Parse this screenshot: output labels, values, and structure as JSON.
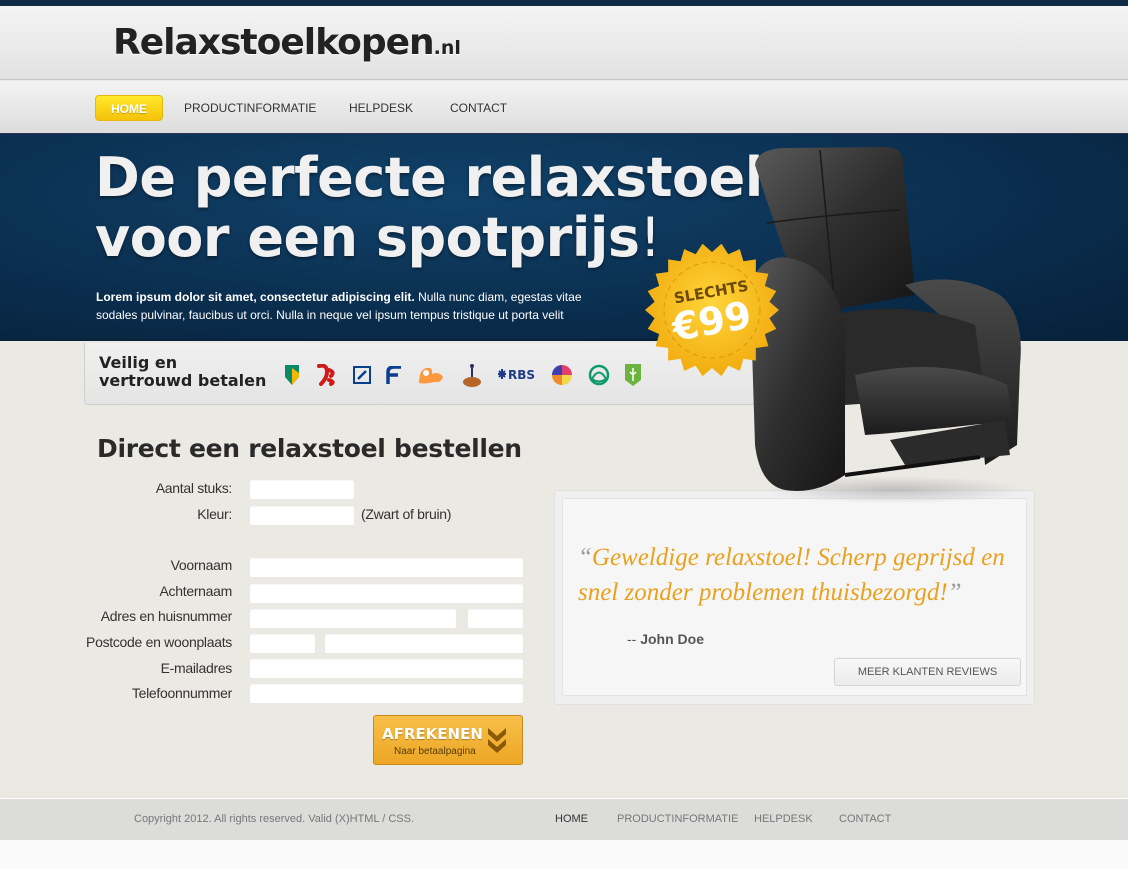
{
  "header": {
    "logo_main": "Relaxstoelkopen",
    "logo_tld": ".nl"
  },
  "nav": {
    "items": [
      {
        "label": "HOME",
        "active": true
      },
      {
        "label": "PRODUCTINFORMATIE",
        "active": false
      },
      {
        "label": "HELPDESK",
        "active": false
      },
      {
        "label": "CONTACT",
        "active": false
      }
    ]
  },
  "hero": {
    "headline_line1": "De perfecte relaxstoel",
    "headline_line2": "voor een spotprijs",
    "headline_excl": "!",
    "intro_bold": "Lorem ipsum dolor sit amet, consectetur adipiscing elit.",
    "intro_rest": " Nulla nunc diam, egestas vitae sodales pulvinar, faucibus ut orci. Nulla in neque vel ipsum tempus tristique ut porta velit",
    "badge_label": "SLECHTS",
    "badge_price": "€99"
  },
  "payment": {
    "title_line1": "Veilig en",
    "title_line2": "vertrouwd betalen",
    "banks": [
      "abn-amro-icon",
      "sns-bank-icon",
      "deutsche-bank-icon",
      "friesland-bank-icon",
      "ing-icon",
      "rabobank-icon",
      "rbs-icon",
      "regiobank-icon",
      "triodos-icon",
      "asn-bank-icon"
    ],
    "rbs_text": "RBS"
  },
  "form": {
    "title": "Direct een relaxstoel bestellen",
    "fields": {
      "quantity": {
        "label": "Aantal stuks:",
        "value": ""
      },
      "color": {
        "label": "Kleur:",
        "value": "",
        "hint": "(Zwart of bruin)"
      },
      "first_name": {
        "label": "Voornaam",
        "value": ""
      },
      "last_name": {
        "label": "Achternaam",
        "value": ""
      },
      "address": {
        "label": "Adres en huisnummer",
        "street_value": "",
        "number_value": ""
      },
      "postal": {
        "label": "Postcode en woonplaats",
        "postcode_value": "",
        "city_value": ""
      },
      "email": {
        "label": "E-mailadres",
        "value": ""
      },
      "phone": {
        "label": "Telefoonnummer",
        "value": ""
      }
    },
    "submit_label": "AFREKENEN",
    "submit_sub": "Naar betaalpagina"
  },
  "review": {
    "open_quote": "“",
    "text": "Geweldige relaxstoel! Scherp geprijsd en snel zonder problemen thuisbezorgd!",
    "close_quote": "”",
    "dash": "-- ",
    "author": "John Doe",
    "more_label": "MEER KLANTEN REVIEWS"
  },
  "footer": {
    "copyright": "Copyright 2012. All rights reserved. Valid (X)HTML / CSS.",
    "nav": [
      {
        "label": "HOME",
        "active": true
      },
      {
        "label": "PRODUCTINFORMATIE",
        "active": false
      },
      {
        "label": "HELPDESK",
        "active": false
      },
      {
        "label": "CONTACT",
        "active": false
      }
    ]
  },
  "colors": {
    "accent_yellow": "#f5c20a",
    "hero_blue": "#0a2d4d",
    "quote_orange": "#e9a11f"
  }
}
